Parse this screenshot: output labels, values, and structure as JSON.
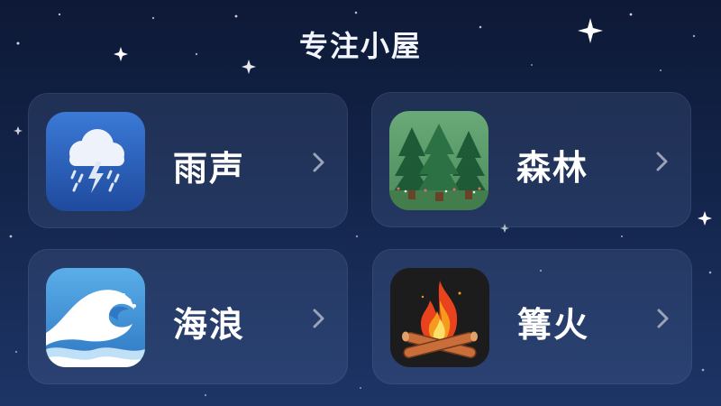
{
  "header": {
    "title": "专注小屋"
  },
  "colors": {
    "background_top": "#0d1936",
    "background_bottom": "#1d3566",
    "card_fill": "rgba(120,145,195,0.16)",
    "text": "#ffffff",
    "chevron": "#9aa3b8"
  },
  "sounds": [
    {
      "label": "雨声",
      "icon": "rain-cloud-lightning-icon",
      "icon_bg": "#2a5cb8"
    },
    {
      "label": "森林",
      "icon": "pine-forest-icon",
      "icon_bg": "#5a9a6a"
    },
    {
      "label": "海浪",
      "icon": "ocean-wave-icon",
      "icon_bg": "#3f8ed4"
    },
    {
      "label": "篝火",
      "icon": "campfire-icon",
      "icon_bg": "#1c1c1c"
    }
  ]
}
